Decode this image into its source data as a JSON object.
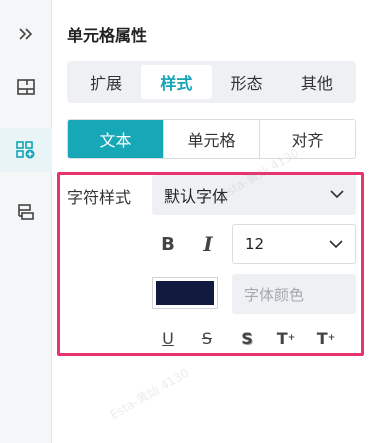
{
  "rail": {
    "items": [
      {
        "icon": "double-chevron-right-icon"
      },
      {
        "icon": "layout-grid-icon"
      },
      {
        "icon": "cell-style-icon"
      },
      {
        "icon": "layers-icon"
      }
    ]
  },
  "panel": {
    "title": "单元格属性",
    "tabs": [
      "扩展",
      "样式",
      "形态",
      "其他"
    ],
    "active_tab": "样式",
    "segments": [
      "文本",
      "单元格",
      "对齐"
    ],
    "active_segment": "文本",
    "char_style_label": "字符样式",
    "font_family_value": "默认字体",
    "bold_label": "B",
    "italic_label": "I",
    "font_size_value": "12",
    "font_color_hex": "#111a3e",
    "font_color_placeholder": "字体颜色",
    "decorations": {
      "underline": "U",
      "strikethrough": "S",
      "shadow": "S",
      "superscript": "T",
      "subscript": "T"
    }
  },
  "watermark": "Esta-黄灿 4130"
}
